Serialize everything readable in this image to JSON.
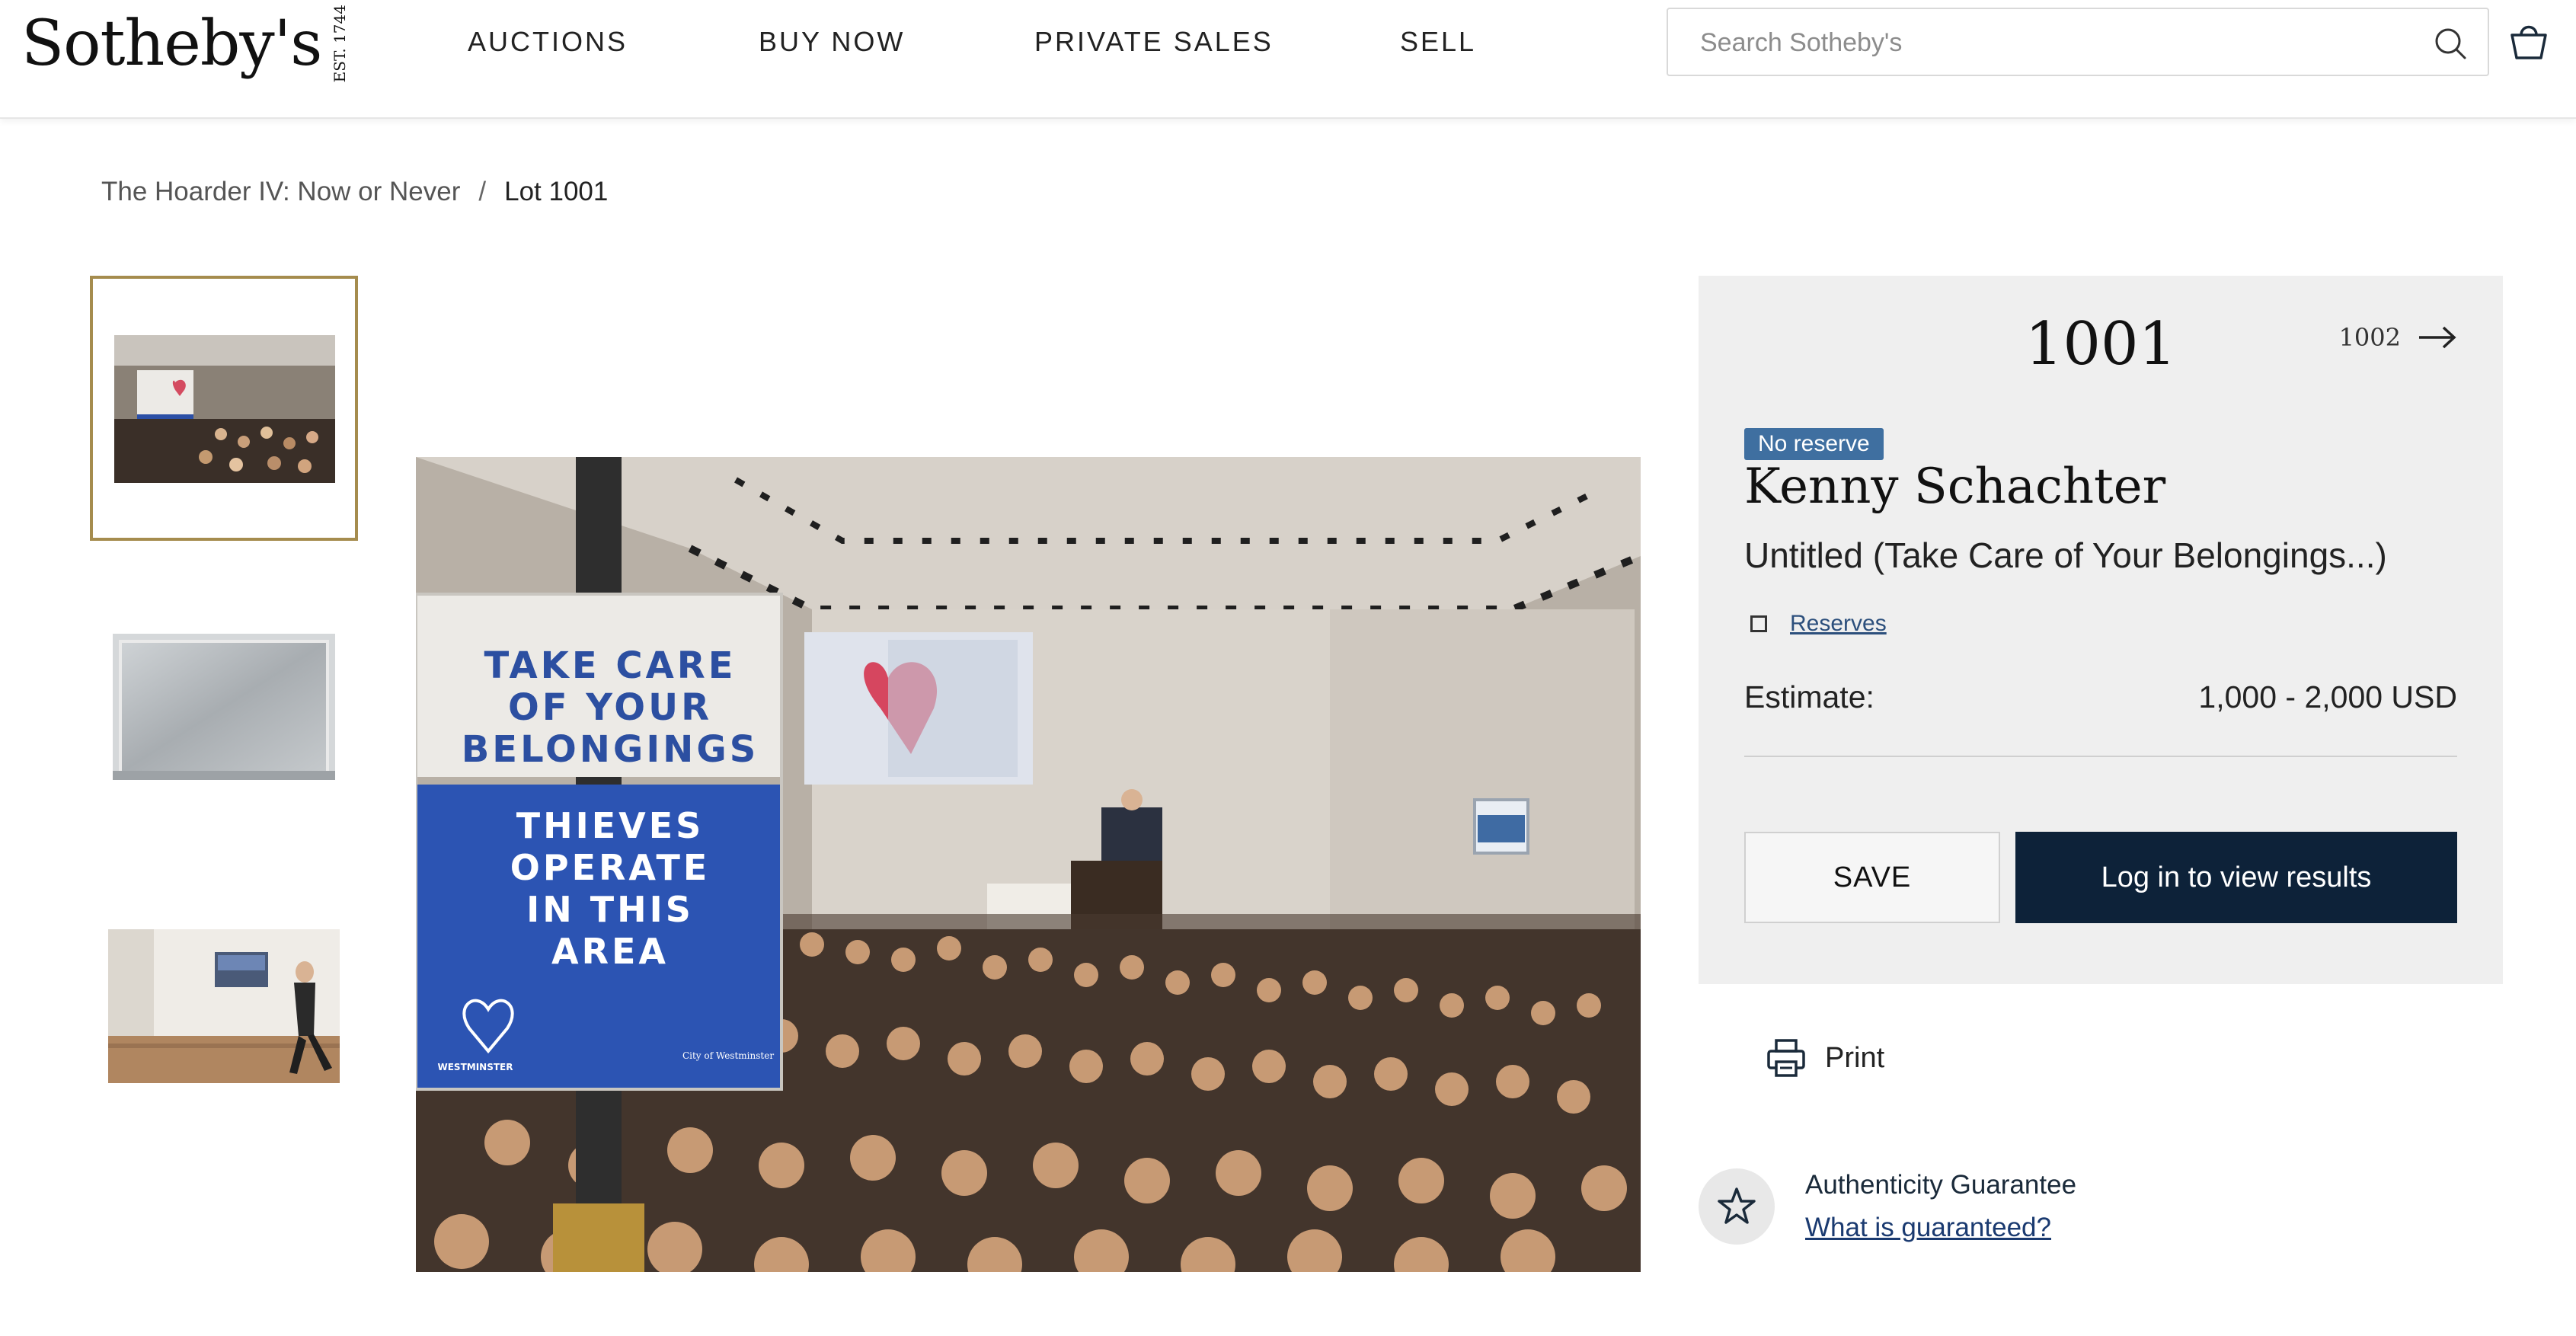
{
  "header": {
    "logo": "Sotheby's",
    "logo_est": "EST. 1744",
    "nav": [
      "AUCTIONS",
      "BUY NOW",
      "PRIVATE SALES",
      "SELL"
    ],
    "search_placeholder": "Search Sotheby's"
  },
  "breadcrumb": {
    "sale": "The Hoarder IV: Now or Never",
    "separator": "/",
    "current": "Lot 1001"
  },
  "gallery": {
    "thumbnails": [
      "auction-room-photo",
      "framed-silver-work",
      "gallery-wall-photo"
    ],
    "selected_index": 0,
    "sign_text": {
      "line1": "TAKE CARE",
      "line2": "OF YOUR",
      "line3": "BELONGINGS",
      "line4": "THIEVES",
      "line5": "OPERATE",
      "line6": "IN THIS",
      "line7": "AREA",
      "footer_left": "WESTMINSTER",
      "footer_right": "City of Westminster"
    }
  },
  "lot": {
    "number": "1001",
    "next_number": "1002",
    "badge": "No reserve",
    "artist": "Kenny Schachter",
    "title": "Untitled (Take Care of Your Belongings...)",
    "reserves_link": "Reserves",
    "estimate_label": "Estimate:",
    "estimate_value": "1,000 - 2,000 USD",
    "save_label": "SAVE",
    "login_label": "Log in to view results"
  },
  "print_label": "Print",
  "authenticity": {
    "title": "Authenticity Guarantee",
    "link": "What is guaranteed?"
  },
  "colors": {
    "navy": "#0d2239",
    "gold_border": "#a58c4e",
    "badge_blue": "#3f6fa0",
    "panel_bg": "#efefef"
  }
}
